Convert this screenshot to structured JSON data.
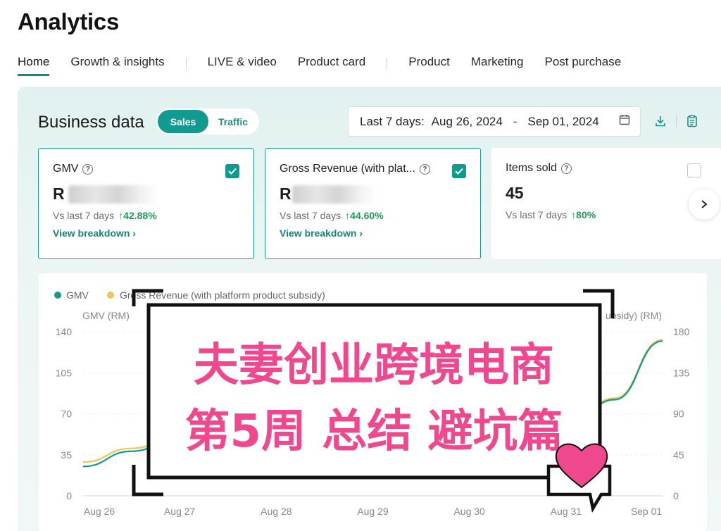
{
  "title": "Analytics",
  "tabs": [
    {
      "label": "Home"
    },
    {
      "label": "Growth & insights"
    },
    {
      "label": "LIVE & video"
    },
    {
      "label": "Product card"
    },
    {
      "label": "Product"
    },
    {
      "label": "Marketing"
    },
    {
      "label": "Post purchase"
    }
  ],
  "business": {
    "title": "Business data",
    "toggle": {
      "sales": "Sales",
      "traffic": "Traffic"
    },
    "date": {
      "label": "Last 7 days:",
      "start": "Aug 26, 2024",
      "sep": "-",
      "end": "Sep 01, 2024"
    }
  },
  "cards": [
    {
      "title": "GMV",
      "value": "R",
      "vs_label": "Vs last 7 days",
      "change": "42.88%",
      "link": "View breakdown",
      "checked": true
    },
    {
      "title": "Gross Revenue (with plat...",
      "value": "R",
      "vs_label": "Vs last 7 days",
      "change": "44.60%",
      "link": "View breakdown",
      "checked": true
    },
    {
      "title": "Items sold",
      "value": "45",
      "vs_label": "Vs last 7 days",
      "change": "80%",
      "checked": false
    }
  ],
  "colors": {
    "accent": "#129a90",
    "gmv_line": "#129a90",
    "revenue_line": "#f0c556",
    "positive": "#229a55",
    "overlay_text": "#f0488f",
    "heart": "#f0488f"
  },
  "chart_data": {
    "type": "line",
    "legend": [
      "GMV",
      "Gross Revenue (with platform product subsidy)"
    ],
    "ylabel_left": "GMV (RM)",
    "ylabel_right": "ubsidy) (RM)",
    "left_ticks": [
      "0",
      "35",
      "70",
      "105",
      "140"
    ],
    "right_ticks": [
      "0",
      "45",
      "90",
      "135",
      "180"
    ],
    "left_ylim": [
      0,
      140
    ],
    "right_ylim": [
      0,
      180
    ],
    "x_ticks": [
      "Aug 26",
      "Aug 27",
      "Aug 28",
      "Aug 29",
      "Aug 30",
      "Aug 31",
      "Sep 01"
    ],
    "series": [
      {
        "name": "GMV",
        "axis": "left",
        "x": [
          "Aug 26",
          "Aug 26 12:00",
          "Aug 27",
          "Aug 31",
          "Aug 31 12:00",
          "Sep 01"
        ],
        "values": [
          25,
          38,
          50,
          55,
          82,
          132
        ]
      },
      {
        "name": "Gross Revenue (with platform product subsidy)",
        "axis": "right",
        "x": [
          "Aug 26",
          "Aug 26 12:00",
          "Aug 27",
          "Aug 31",
          "Aug 31 12:00",
          "Sep 01"
        ],
        "values": [
          37,
          52,
          66,
          72,
          107,
          171
        ]
      }
    ]
  },
  "overlay": {
    "line1": "夫妻创业跨境电商",
    "line2": "第5周 总结 避坑篇"
  }
}
